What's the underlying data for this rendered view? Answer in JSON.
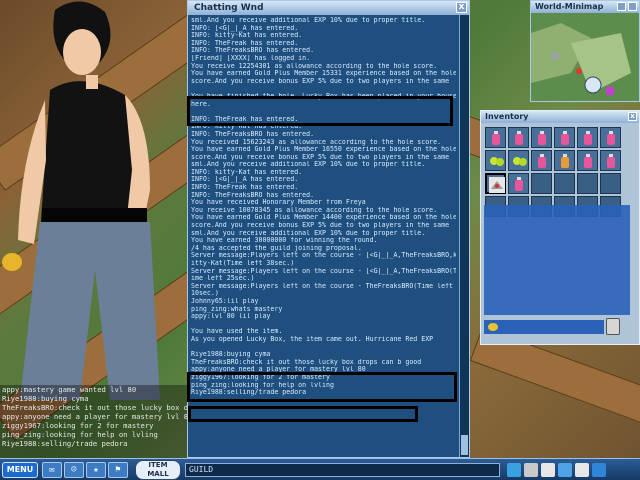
{
  "chat_window": {
    "title": "Chatting Wnd",
    "close_label": "x",
    "lines": [
      "sml.And you receive additional EXP  10% due to proper title.",
      "INFO: [<G|_|_A has entered.",
      "INFO: kitty-Kat has entered.",
      "INFO: TheFreak has entered.",
      "INFO: TheFreaksBRO has entered.",
      "[Friend] [XXXX] has logged in.",
      "You receive 12254301 as allowance according to the hole score.",
      "You have earned Gold Plus Member 15331 experience based on the hole",
      " score.And you receive bonus EXP  5% due to two players in the same",
      "",
      "You have finished the hole. Lucky Box has been placed in your house",
      "here.",
      "",
      "INFO: TheFreak has entered.",
      "INFO: kitty-Kat has entered.",
      "INFO: TheFreaksBRO has entered.",
      "You received 15623243 as allowance according to the hole score.",
      "You have earned Gold Plus Member 16550 experience based on the hole",
      " score.And you receive bonus EXP  5% due to two players in the same",
      "sml.And you receive additional EXP  10% due to proper title.",
      "INFO: kitty-Kat has entered.",
      "INFO: [<G|_|_A has entered.",
      "INFO: TheFreak has entered.",
      "INFO: TheFreaksBRO has entered.",
      "You have received Honorary Member from Freya",
      "You receive 10078345 as allowance according to the hole score.",
      "You have earned Gold Plus Member 14400 experience based on the hole",
      " score.And you receive bonus EXP  5% due to two players in the same",
      "sml.And you receive additional EXP  10% due to proper title.",
      "You have earned 30000000 for winning the round.",
      "/4 has accepted the guild joining proposal.",
      "Server message:Players left on the course - [<G|_|_A,TheFreaksBRO,k",
      "itty-Kat(Time left 38sec.)",
      "Server message:Players left on the course - [<G|_|_A,TheFreaksBRO(T",
      "ime left 25sec.)",
      "Server message:Players left on the course - TheFreaksBRO(Time left",
      " 10sec.)",
      "Johnny65:lil play",
      "ping_zing:whats mastery",
      "appy:lvl 80 lil play",
      "",
      "You have used the item.",
      "As you opened Lucky Box, the item came out. Hurricane  Red EXP",
      "",
      "Riye1988:buying cyma",
      "TheFreaksBRO:check it out  those lucky box drops can b good",
      "appy:anyone need a player for mastery lvl 80",
      "ziggy1967:looking for 2 for mastery",
      "ping_zing:looking for help on lvling",
      "Riye1988:selling/trade pedora"
    ]
  },
  "minimap": {
    "title": "World-Minimap"
  },
  "inventory": {
    "title": "Inventory",
    "close_label": "x"
  },
  "left_chat": {
    "lines": [
      "appy:mastery game wanted lvl 80",
      "Riye1988:buying cyma",
      "TheFreaksBRO:check it out  those lucky box drop",
      "appy:anyone need a player for mastery lvl 80",
      "ziggy1967:looking for 2 for mastery",
      "ping_zing:looking for help on lvling",
      "Riye1988:selling/trade pedora"
    ]
  },
  "bottom_bar": {
    "menu_label": "MENU",
    "item_mall_line1": "ITEM",
    "item_mall_line2": "MALL",
    "chat_channel": "GUILD"
  },
  "colors": {
    "chat_bg": "#1f4f7e",
    "chat_text": "#d7ecff",
    "highlight_box": "#000000",
    "inventory_bg": "#b0c4d8"
  }
}
